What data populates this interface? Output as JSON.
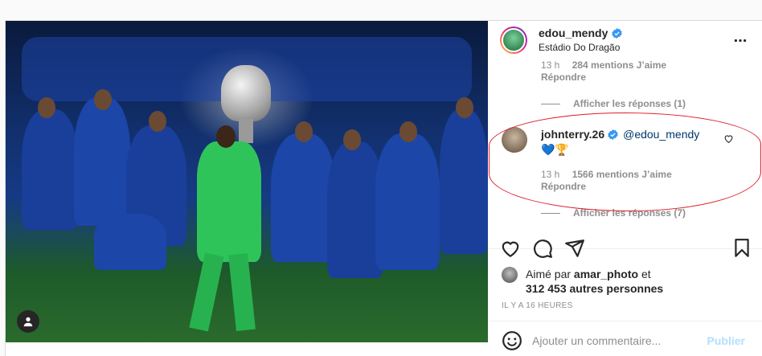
{
  "header": {
    "username": "edou_mendy",
    "location": "Estádio Do Dragão"
  },
  "prev_comment": {
    "time": "13 h",
    "likes": "284 mentions J’aime",
    "reply": "Répondre",
    "show_replies": "Afficher les réponses (1)"
  },
  "highlighted_comment": {
    "username": "johnterry.26",
    "mention": "@edou_mendy",
    "emojis": "💙🏆",
    "time": "13 h",
    "likes": "1566 mentions J’aime",
    "reply": "Répondre",
    "show_replies": "Afficher les réponses (7)"
  },
  "likes": {
    "prefix": "Aimé par",
    "user": "amar_photo",
    "conj": "et",
    "others": "312 453 autres personnes"
  },
  "timestamp": "IL Y A 16 HEURES",
  "comment_box": {
    "placeholder": "Ajouter un commentaire...",
    "publish": "Publier"
  },
  "colors": {
    "verified_blue": "#3897f0",
    "highlight_red": "#e01b2a",
    "publish_disabled": "#b2dffc",
    "mention": "#00376b"
  },
  "icons": [
    "user-tag-icon",
    "verified-icon",
    "more-options-icon",
    "heart-icon",
    "comment-icon",
    "share-icon",
    "bookmark-icon",
    "emoji-icon"
  ]
}
